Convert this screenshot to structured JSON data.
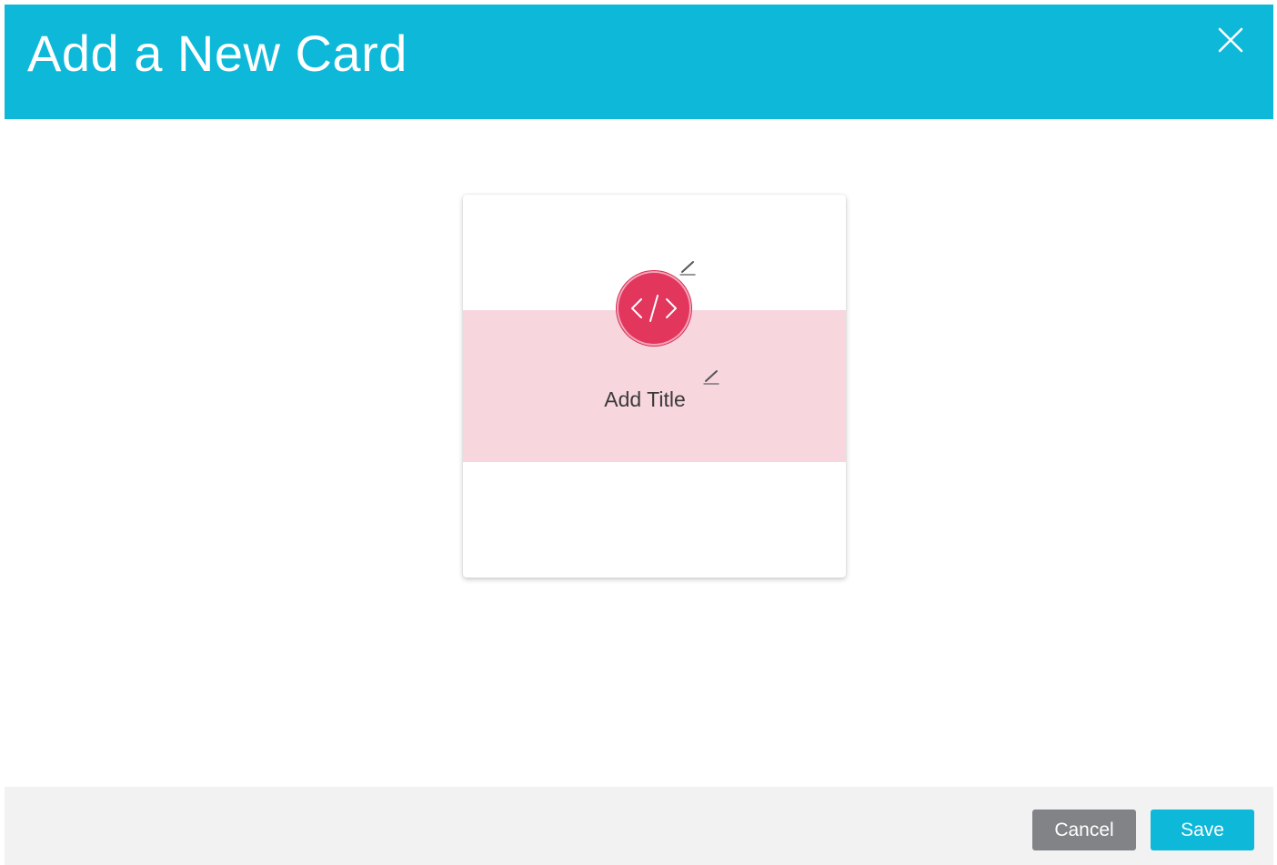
{
  "dialog": {
    "title": "Add a New Card",
    "close_icon": "close-icon",
    "header_color": "#0db8d9"
  },
  "card": {
    "icon": "code-icon",
    "icon_glyph": "</>",
    "icon_color": "#e2365d",
    "band_color": "#f7d6de",
    "title": "Add Title",
    "edit_icon": "pencil-icon"
  },
  "footer": {
    "cancel_label": "Cancel",
    "save_label": "Save",
    "cancel_color": "#818386",
    "save_color": "#0db8d9"
  }
}
